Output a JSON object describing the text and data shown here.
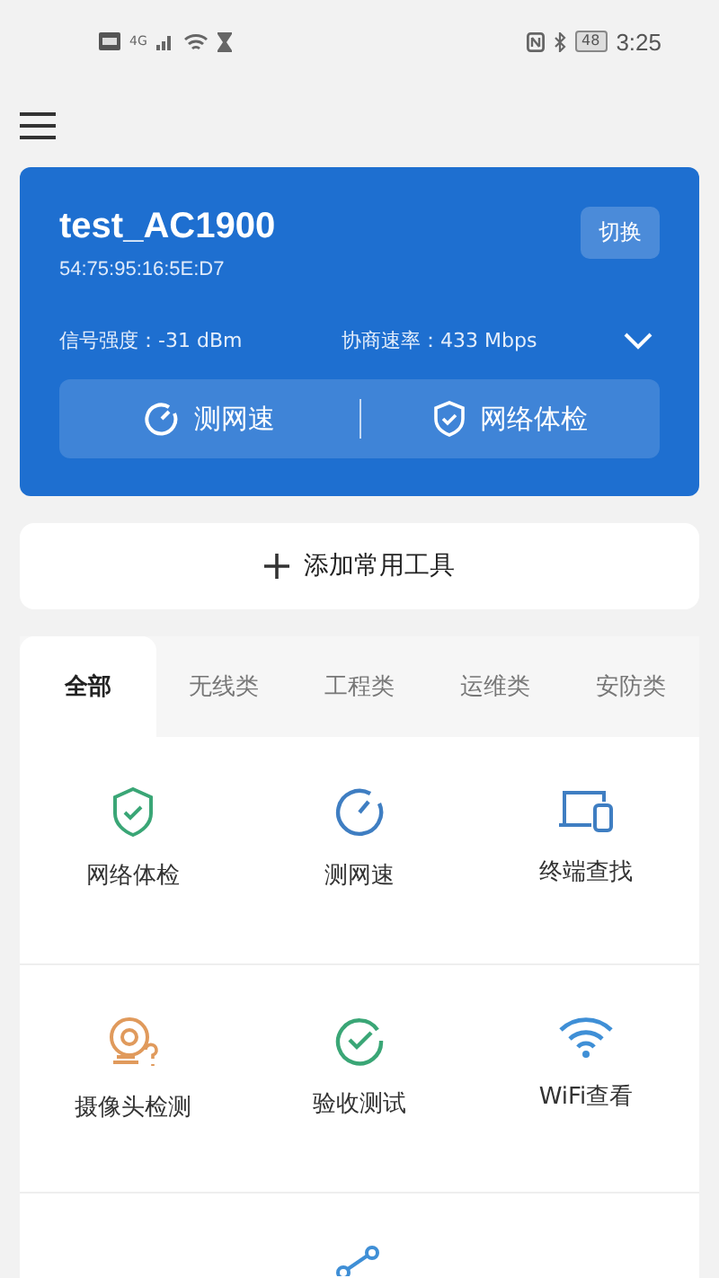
{
  "status_bar": {
    "network": "4G",
    "battery": "48",
    "time": "3:25"
  },
  "device": {
    "name": "test_AC1900",
    "mac": "54:75:95:16:5E:D7",
    "switch_button": "切换",
    "signal": "信号强度：-31 dBm",
    "rate": "协商速率：433 Mbps",
    "actions": [
      {
        "kind": "speed",
        "label": "测网速"
      },
      {
        "kind": "check",
        "label": "网络体检"
      }
    ]
  },
  "add_tools": "添加常用工具",
  "tabs": [
    {
      "label": "全部",
      "selected": true
    },
    {
      "label": "无线类",
      "selected": false
    },
    {
      "label": "工程类",
      "selected": false
    },
    {
      "label": "运维类",
      "selected": false
    },
    {
      "label": "安防类",
      "selected": false
    }
  ],
  "tools": [
    {
      "kind": "shield",
      "label": "网络体检"
    },
    {
      "kind": "gauge",
      "label": "测网速"
    },
    {
      "kind": "devices",
      "label": "终端查找"
    },
    {
      "kind": "camera",
      "label": "摄像头检测"
    },
    {
      "kind": "tick",
      "label": "验收测试"
    },
    {
      "kind": "wifi",
      "label": "WiFi查看"
    },
    {
      "kind": "nodes"
    }
  ]
}
